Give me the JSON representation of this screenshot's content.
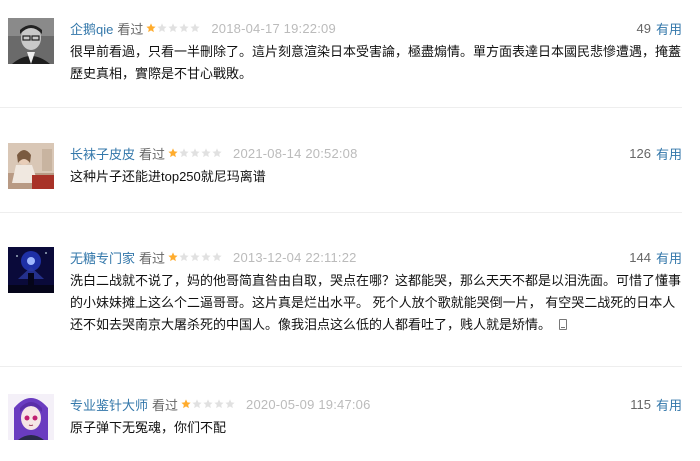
{
  "reviews": [
    {
      "user": "企鹅qie",
      "watched": "看过",
      "rating": 1,
      "time": "2018-04-17 19:22:09",
      "votes": "49",
      "vote_label": "有用",
      "content": "很早前看過，只看一半刪除了。這片刻意渲染日本受害論，極盡煽情。單方面表達日本國民悲慘遭遇，掩蓋歷史真相，實際是不甘心戰敗。",
      "avatar": "portrait-man-glasses"
    },
    {
      "user": "长袜子皮皮",
      "watched": "看过",
      "rating": 1,
      "time": "2021-08-14 20:52:08",
      "votes": "126",
      "vote_label": "有用",
      "content": "这种片子还能进top250就尼玛离谱",
      "avatar": "portrait-figure-red"
    },
    {
      "user": "无糖专门家",
      "watched": "看过",
      "rating": 1,
      "time": "2013-12-04 22:11:22",
      "votes": "144",
      "vote_label": "有用",
      "content": "洗白二战就不说了，妈的他哥简直咎由自取，哭点在哪？这都能哭，那么天天不都是以泪洗面。可惜了懂事的小妹妹摊上这么个二逼哥哥。这片真是烂出水平。 死个人放个歌就能哭倒一片， 有空哭二战死的日本人还不如去哭南京大屠杀死的中国人。像我泪点这么低的人都看吐了，贱人就是矫情。",
      "mobile_icon": "phone-icon",
      "avatar": "night-scene-blue"
    },
    {
      "user": "专业鉴针大师",
      "watched": "看过",
      "rating": 1,
      "time": "2020-05-09 19:47:06",
      "votes": "115",
      "vote_label": "有用",
      "content": "原子弹下无冤魂，你们不配",
      "avatar": "anime-girl-purple"
    }
  ],
  "colors": {
    "link": "#3377aa",
    "star_filled": "#ffac2d",
    "star_empty": "#e1e1e1",
    "time": "#bbbbbb",
    "divider": "#eeeeee"
  }
}
